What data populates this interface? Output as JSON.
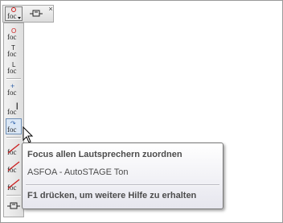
{
  "toolbar_top": {
    "buttons": [
      {
        "icon": "foc-dropdown-icon",
        "glyph": "foc"
      },
      {
        "icon": "dock-icon"
      }
    ],
    "close_glyph": "×"
  },
  "toolbar_vertical": {
    "buttons": [
      {
        "icon": "foc-o-icon",
        "glyph": "foc",
        "mark": "O"
      },
      {
        "icon": "foc-t-icon",
        "glyph": "foc",
        "mark": "T"
      },
      {
        "icon": "foc-l-icon",
        "glyph": "foc",
        "mark": "L"
      },
      {
        "icon": "foc-plus-icon",
        "glyph": "foc",
        "mark": "+"
      },
      {
        "icon": "foc-bar-icon",
        "glyph": "foc",
        "mark": "|"
      },
      {
        "icon": "foc-arrow-icon",
        "glyph": "foc",
        "mark": "↷"
      },
      {
        "icon": "foc-strike-1-icon",
        "glyph": "foc"
      },
      {
        "icon": "foc-strike-2-icon",
        "glyph": "foc"
      },
      {
        "icon": "foc-strike-3-icon",
        "glyph": "foc"
      },
      {
        "icon": "dock-icon"
      }
    ]
  },
  "tooltip": {
    "title": "Focus allen Lautsprechern zuordnen",
    "subtitle": "ASFOA - AutoSTAGE Ton",
    "help": "F1 drücken, um weitere Hilfe zu erhalten"
  },
  "colors": {
    "accent_red": "#cc2222",
    "accent_blue": "#2b5ea8",
    "text": "#4c4c4c"
  }
}
